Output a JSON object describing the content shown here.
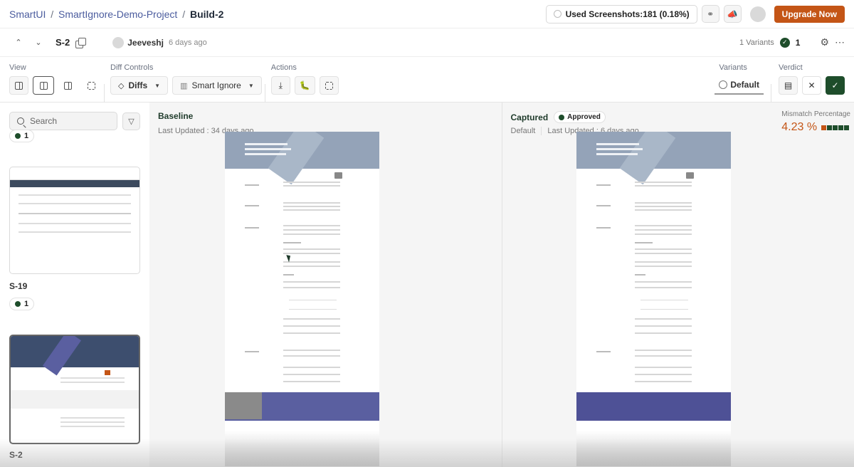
{
  "breadcrumb": {
    "items": [
      "SmartUI",
      "SmartIgnore-Demo-Project"
    ],
    "separator": "/",
    "current": "Build-2"
  },
  "header": {
    "usage_label": "Used Screenshots:181 (0.18%)",
    "upgrade_label": "Upgrade Now",
    "link_icon": "link-icon",
    "announce_icon": "megaphone-icon"
  },
  "subheader": {
    "screenshot_id": "S-2",
    "user_name": "Jeeveshj",
    "user_time": "6 days ago",
    "variants_label": "1 Variants",
    "approved_count": "1"
  },
  "toolbar": {
    "view_label": "View",
    "diff_controls_label": "Diff Controls",
    "diffs_label": "Diffs",
    "smart_ignore_label": "Smart Ignore",
    "actions_label": "Actions",
    "variants_label": "Variants",
    "variant_default": "Default",
    "verdict_label": "Verdict"
  },
  "sidebar": {
    "search_placeholder": "Search",
    "top_count": "1",
    "items": [
      {
        "name": "S-19",
        "count": "1"
      },
      {
        "name": "S-2",
        "count": "1",
        "selected": true
      }
    ]
  },
  "baseline": {
    "title": "Baseline",
    "updated": "Last Updated : 34 days ago"
  },
  "captured": {
    "title": "Captured",
    "status": "Approved",
    "variant": "Default",
    "updated": "Last Updated : 6 days ago"
  },
  "mismatch": {
    "label": "Mismatch Percentage",
    "value": "4.23 %",
    "percent": 4.23,
    "segments_hot": 1,
    "segments_total": 5
  },
  "colors": {
    "accent_orange": "#c45516",
    "approved_green": "#1e4d2b",
    "link_blue": "#4b5c9e"
  }
}
